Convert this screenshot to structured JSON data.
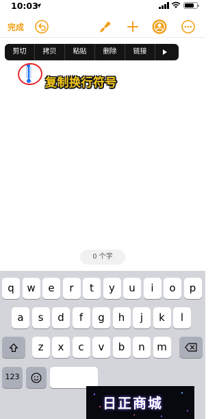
{
  "status_bar": {
    "time": "10:03",
    "battery_level": 0.75
  },
  "toolbar": {
    "done_label": "完成",
    "icons": [
      "undo-icon",
      "brush-icon",
      "plus-icon",
      "person-circle-icon",
      "more-icon"
    ],
    "accent_color": "#f0a018"
  },
  "context_menu": {
    "items": [
      "剪切",
      "拷贝",
      "粘贴",
      "删除",
      "链接"
    ],
    "more_icon": "triangle-right-icon"
  },
  "document": {
    "caption": "复制换行符号",
    "caption_color": "#f5c81a"
  },
  "word_count": "0 个字",
  "keyboard": {
    "row1": [
      "q",
      "w",
      "e",
      "r",
      "t",
      "y",
      "u",
      "i",
      "o",
      "p"
    ],
    "row2": [
      "a",
      "s",
      "d",
      "f",
      "g",
      "h",
      "j",
      "k",
      "l"
    ],
    "row3": [
      "z",
      "x",
      "c",
      "v",
      "b",
      "n",
      "m"
    ],
    "row4": [
      "123"
    ]
  },
  "watermark": {
    "text": "日正商城"
  }
}
